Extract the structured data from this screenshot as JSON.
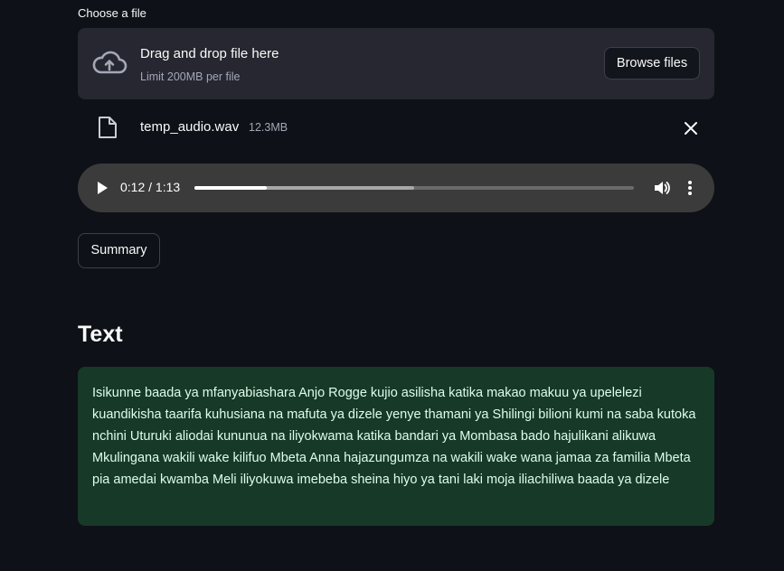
{
  "uploader": {
    "label": "Choose a file",
    "drop_title": "Drag and drop file here",
    "drop_limit": "Limit 200MB per file",
    "browse_label": "Browse files",
    "upload_icon": "cloud-upload-icon"
  },
  "file": {
    "name": "temp_audio.wav",
    "size": "12.3MB",
    "file_icon": "file-icon",
    "remove_icon": "close-icon"
  },
  "audio": {
    "time": "0:12 / 1:13",
    "current_seconds": 12,
    "duration_seconds": 73,
    "buffered_fraction": 0.5,
    "play_icon": "play-icon",
    "volume_icon": "volume-icon",
    "more_icon": "more-vertical-icon"
  },
  "actions": {
    "summary_label": "Summary"
  },
  "result": {
    "heading": "Text",
    "body": "Isikunne baada ya mfanyabiashara Anjo Rogge kujio asilisha katika makao makuu ya upelelezi kuandikisha taarifa kuhusiana na mafuta ya dizele yenye thamani ya Shilingi bilioni kumi na saba kutoka nchini Uturuki aliodai kununua na iliyokwama katika bandari ya Mombasa bado hajulikani alikuwa Mkulingana wakili wake kilifuo Mbeta Anna hajazungumza na wakili wake wana jamaa za familia Mbeta pia amedai kwamba Meli iliyokuwa imebeba sheina hiyo ya tani laki moja iliachiliwa baada ya dizele"
  },
  "colors": {
    "background": "#0e1117",
    "dropzone": "#262730",
    "audio_player": "#3b3b3b",
    "result_box": "#173928",
    "result_text": "#dffde9"
  }
}
